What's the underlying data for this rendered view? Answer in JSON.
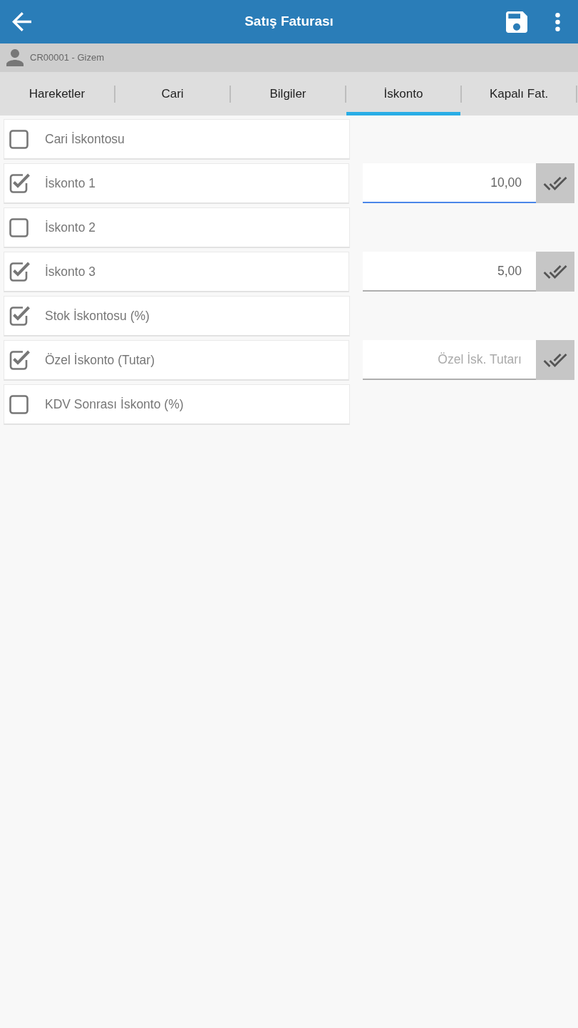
{
  "app_bar": {
    "title": "Satış Faturası"
  },
  "customer_bar": {
    "label": "CR00001 - Gizem"
  },
  "tabs": [
    {
      "label": "Hareketler",
      "selected": false
    },
    {
      "label": "Cari",
      "selected": false
    },
    {
      "label": "Bilgiler",
      "selected": false
    },
    {
      "label": "İskonto",
      "selected": true
    },
    {
      "label": "Kapalı Fat.",
      "selected": false
    }
  ],
  "discounts": [
    {
      "label": "Cari İskontosu",
      "checked": false
    },
    {
      "label": "İskonto 1",
      "checked": true,
      "field": {
        "value": "10,00",
        "focused": true
      }
    },
    {
      "label": "İskonto 2",
      "checked": false
    },
    {
      "label": "İskonto 3",
      "checked": true,
      "field": {
        "value": "5,00",
        "focused": false
      }
    },
    {
      "label": "Stok İskontosu (%)",
      "checked": true
    },
    {
      "label": "Özel İskonto (Tutar)",
      "checked": true,
      "field": {
        "placeholder": "Özel İsk. Tutarı",
        "focused": false
      }
    },
    {
      "label": "KDV Sonrası İskonto (%)",
      "checked": false
    }
  ]
}
